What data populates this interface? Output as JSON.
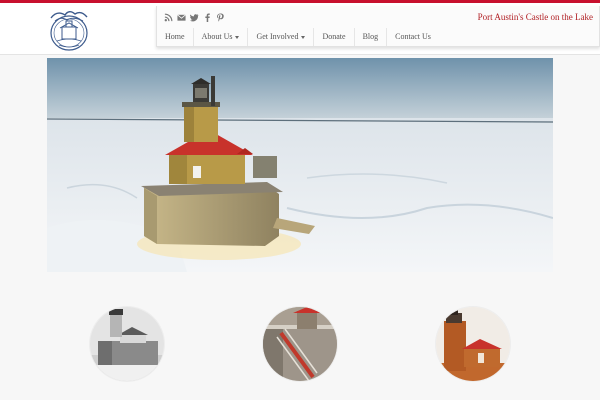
{
  "site": {
    "title": "Port Austin's Castle on the Lake"
  },
  "social_icons": [
    "rss-icon",
    "envelope-icon",
    "twitter-icon",
    "facebook-icon",
    "pinterest-icon"
  ],
  "nav": {
    "items": [
      {
        "label": "Home",
        "dropdown": false
      },
      {
        "label": "About Us",
        "dropdown": true
      },
      {
        "label": "Get Involved",
        "dropdown": true
      },
      {
        "label": "Donate",
        "dropdown": false
      },
      {
        "label": "Blog",
        "dropdown": false
      },
      {
        "label": "Contact Us",
        "dropdown": false
      }
    ]
  },
  "colors": {
    "accent": "#c8102e",
    "title_red": "#b01e23",
    "nav_text": "#555555",
    "page_bg": "#f7f7f7"
  }
}
